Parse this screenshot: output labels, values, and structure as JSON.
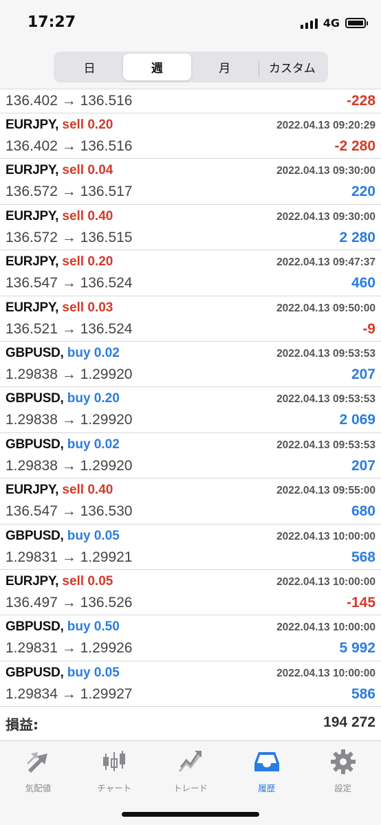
{
  "status_bar": {
    "time": "17:27",
    "network": "4G"
  },
  "period_tabs": [
    {
      "label": "日",
      "active": false
    },
    {
      "label": "週",
      "active": true
    },
    {
      "label": "月",
      "active": false
    },
    {
      "label": "カスタム",
      "active": false
    }
  ],
  "first_row": {
    "prices": "136.402 → 136.516",
    "profit": "-228"
  },
  "trades": [
    {
      "symbol": "EURJPY,",
      "side": "sell 0.20",
      "time": "2022.04.13 09:20:29",
      "prices": "136.402 → 136.516",
      "profit": "-2 280"
    },
    {
      "symbol": "EURJPY,",
      "side": "sell 0.04",
      "time": "2022.04.13 09:30:00",
      "prices": "136.572 → 136.517",
      "profit": "220"
    },
    {
      "symbol": "EURJPY,",
      "side": "sell 0.40",
      "time": "2022.04.13 09:30:00",
      "prices": "136.572 → 136.515",
      "profit": "2 280"
    },
    {
      "symbol": "EURJPY,",
      "side": "sell 0.20",
      "time": "2022.04.13 09:47:37",
      "prices": "136.547 → 136.524",
      "profit": "460"
    },
    {
      "symbol": "EURJPY,",
      "side": "sell 0.03",
      "time": "2022.04.13 09:50:00",
      "prices": "136.521 → 136.524",
      "profit": "-9"
    },
    {
      "symbol": "GBPUSD,",
      "side": "buy 0.02",
      "time": "2022.04.13 09:53:53",
      "prices": "1.29838 → 1.29920",
      "profit": "207"
    },
    {
      "symbol": "GBPUSD,",
      "side": "buy 0.20",
      "time": "2022.04.13 09:53:53",
      "prices": "1.29838 → 1.29920",
      "profit": "2 069"
    },
    {
      "symbol": "GBPUSD,",
      "side": "buy 0.02",
      "time": "2022.04.13 09:53:53",
      "prices": "1.29838 → 1.29920",
      "profit": "207"
    },
    {
      "symbol": "EURJPY,",
      "side": "sell 0.40",
      "time": "2022.04.13 09:55:00",
      "prices": "136.547 → 136.530",
      "profit": "680"
    },
    {
      "symbol": "GBPUSD,",
      "side": "buy 0.05",
      "time": "2022.04.13 10:00:00",
      "prices": "1.29831 → 1.29921",
      "profit": "568"
    },
    {
      "symbol": "EURJPY,",
      "side": "sell 0.05",
      "time": "2022.04.13 10:00:00",
      "prices": "136.497 → 136.526",
      "profit": "-145"
    },
    {
      "symbol": "GBPUSD,",
      "side": "buy 0.50",
      "time": "2022.04.13 10:00:00",
      "prices": "1.29831 → 1.29926",
      "profit": "5 992"
    },
    {
      "symbol": "GBPUSD,",
      "side": "buy 0.05",
      "time": "2022.04.13 10:00:00",
      "prices": "1.29834 → 1.29927",
      "profit": "586"
    }
  ],
  "summary": {
    "label": "損益:",
    "value": "194 272"
  },
  "tab_bar": [
    {
      "label": "気配値",
      "icon": "quotes-icon",
      "active": false
    },
    {
      "label": "チャート",
      "icon": "chart-candles-icon",
      "active": false
    },
    {
      "label": "トレード",
      "icon": "trade-icon",
      "active": false
    },
    {
      "label": "履歴",
      "icon": "history-inbox-icon",
      "active": true
    },
    {
      "label": "設定",
      "icon": "gear-icon",
      "active": false
    }
  ],
  "colors": {
    "sell": "#d23b2a",
    "buy": "#2b7de0",
    "active_tab": "#2b7de0",
    "inactive_tab": "#8a8a8e"
  }
}
